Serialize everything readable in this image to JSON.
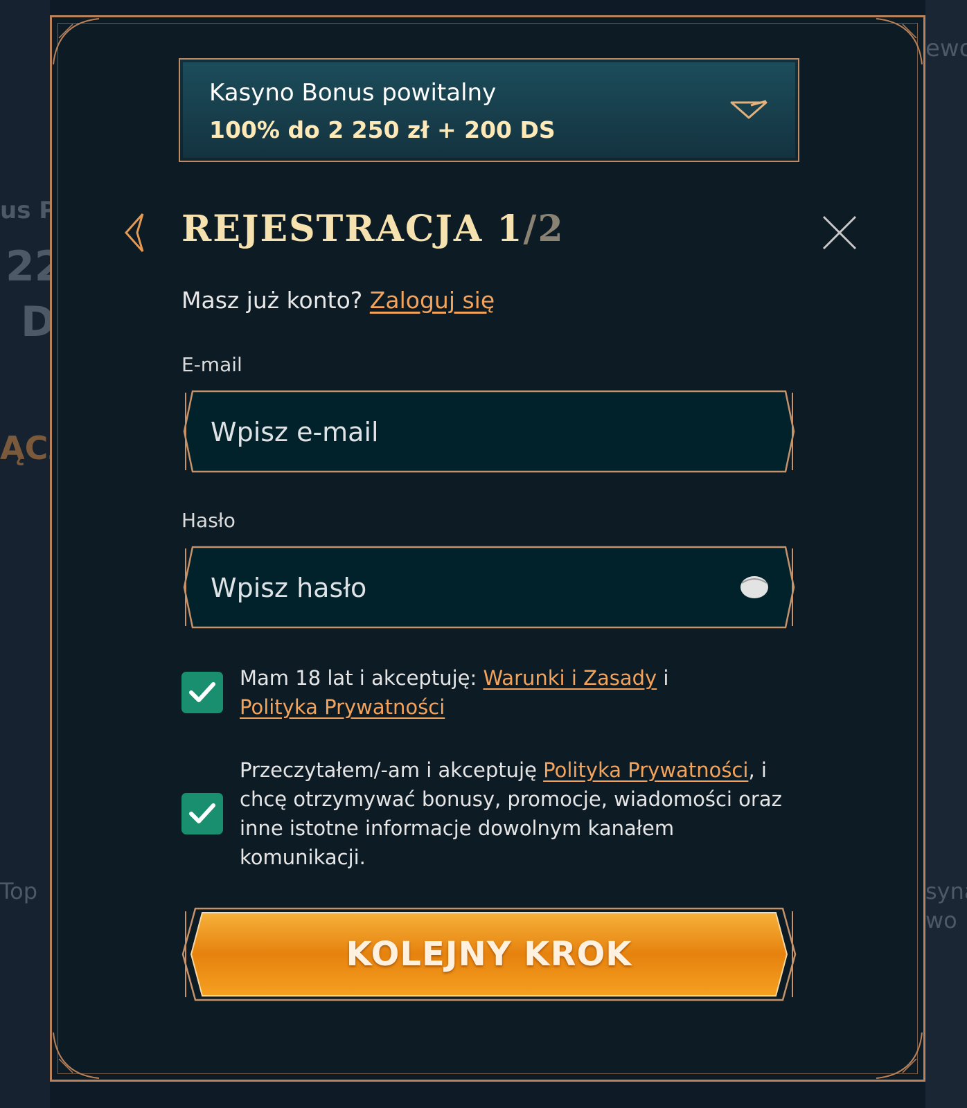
{
  "background": {
    "left_fragments": [
      "us Pc",
      "22",
      "D",
      "ĄCZ",
      "Top"
    ],
    "right_fragments": [
      "ewo",
      "syna",
      "wo"
    ]
  },
  "bonus": {
    "title": "Kasyno Bonus powitalny",
    "value": "100% do 2 250 zł + 200 DS",
    "icon": "chevron-down-icon"
  },
  "header": {
    "title": "REJESTRACJA 1",
    "step_total": "/2",
    "back_icon": "chevron-left-icon",
    "close_icon": "close-icon"
  },
  "login_prompt": {
    "text": "Masz już konto? ",
    "link": "Zaloguj się"
  },
  "email": {
    "label": "E-mail",
    "placeholder": "Wpisz e-mail",
    "value": ""
  },
  "password": {
    "label": "Hasło",
    "placeholder": "Wpisz hasło",
    "value": "",
    "icon": "eye-icon"
  },
  "consents": [
    {
      "checked": true,
      "text_before": "Mam 18 lat i akceptuję: ",
      "link1": "Warunki i Zasady",
      "text_middle": " i",
      "link2": "Polityka Prywatności"
    },
    {
      "checked": true,
      "text_before": "Przeczytałem/-am i akceptuję ",
      "link1": "Polityka Prywatności",
      "text_after": ", i chcę otrzymywać bonusy, promocje, wiadomości oraz inne istotne informacje dowolnym kanałem komunikacji."
    }
  ],
  "next_button": {
    "label": "KOLEJNY KROK"
  },
  "colors": {
    "accent_gold": "#b9825a",
    "link_orange": "#f4a35a",
    "checkbox_green": "#1a8f6f",
    "button_orange": "#f39a1e",
    "title_cream": "#f6e2ae"
  }
}
